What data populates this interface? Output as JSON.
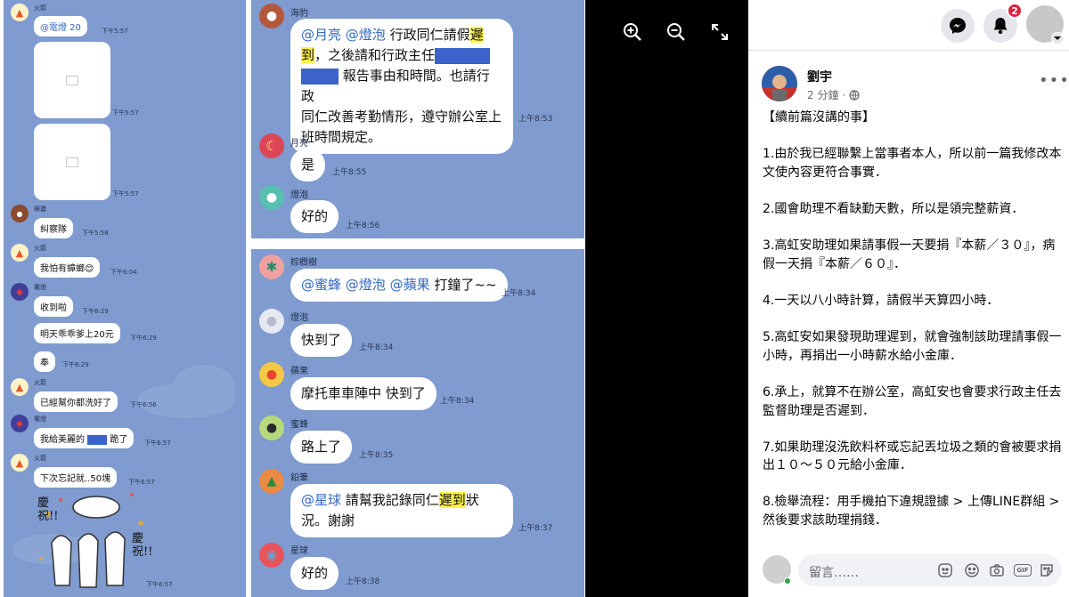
{
  "viewer": {
    "zoom_in": "zoom-in",
    "zoom_out": "zoom-out",
    "fullscreen": "fullscreen"
  },
  "left_chat": [
    {
      "name": "火箭",
      "text": "@電燈  20",
      "time": "下午5:57"
    },
    {
      "time": "下午5:57"
    },
    {
      "time": "下午5:57"
    },
    {
      "name": "檸寶",
      "text": "糾察隊",
      "time": "下午5:58"
    },
    {
      "name": "火箭",
      "text": "我怕有蟑螂😊",
      "time": "下午6:04"
    },
    {
      "name": "電燈",
      "text": "收到啦",
      "time": "下午6:29"
    },
    {
      "text": "明天乖乖爹上20元",
      "time": "下午6:29"
    },
    {
      "text": "奉",
      "time": "下午6:29"
    },
    {
      "name": "火箭",
      "text": "已經幫你都洗好了",
      "time": "下午6:56"
    },
    {
      "name": "電燈",
      "text_a": "我給美麗的",
      "text_b": " 跪了",
      "time": "下午6:57"
    },
    {
      "name": "火箭",
      "text": "下次忘記就..50塊",
      "time": "下午6:57"
    },
    {
      "time": "下午6:57",
      "sticker_a": "慶祝!!",
      "sticker_b": "慶祝!!"
    }
  ],
  "mid_top": {
    "name": "海豹",
    "m1": "@月亮",
    "m2": "@燈泡",
    "t1": " 行政同仁請假",
    "t1h": "遲",
    "t2h": "到",
    "t2": "，之後請和行政主任",
    "t3": " 報告事由和時間。也請行政",
    "t4": "同仁改善考勤情形，遵守辦公室上",
    "t5": "班時間規定。",
    "time": "上午8:53",
    "r2_name": "月亮",
    "r2_text": "是",
    "r2_time": "上午8:55",
    "r3_name": "燈泡",
    "r3_text": "好的",
    "r3_time": "上午8:56"
  },
  "mid_bot": {
    "a_name": "棕櫚樹",
    "a_m1": "@蜜蜂",
    "a_m2": "@燈泡",
    "a_m3": "@蘋果",
    "a_text": " 打鐘了~~",
    "a_time": "上午8:34",
    "b_name": "燈泡",
    "b_text": "快到了",
    "b_time": "上午8:34",
    "c_name": "蘋果",
    "c_text": "摩托車車陣中 快到了",
    "c_time": "上午8:34",
    "d_name": "蜜蜂",
    "d_text": "路上了",
    "d_time": "上午8:35",
    "e_name": "鉛筆",
    "e_m1": "@星球",
    "e_t1": " 請幫我記錄同仁",
    "e_h": "遲到",
    "e_t2": "狀",
    "e_t3": "況。謝謝",
    "e_time": "上午8:37",
    "f_name": "星球",
    "f_text": "好的",
    "f_time": "上午8:38"
  },
  "fb": {
    "badge": "2",
    "author": "劉宇",
    "time": "2 分鐘",
    "text": "【續前篇沒講的事】\n\n1.由於我已經聯繫上當事者本人，所以前一篇我修改本文使內容更符合事實．\n\n2.國會助理不看缺勤天數，所以是領完整薪資．\n\n3.高虹安助理如果請事假一天要捐『本薪／３０』，病假一天捐『本薪／６０』．\n\n4.一天以八小時計算，請假半天算四小時．\n\n5.高虹安如果發現助理遲到，就會強制該助理請事假一小時，再捐出一小時薪水給小金庫．\n\n6.承上，就算不在辦公室，高虹安也會要求行政主任去監督助理是否遲到．\n\n7.如果助理沒洗飲料杯或忘記丟垃圾之類的會被要求捐出１０～５０元給小金庫．\n\n8.檢舉流程：用手機拍下違規證據 > 上傳LINE群組 > 然後要求該助理捐錢．",
    "comment_placeholder": "留言……",
    "gif": "GIF"
  },
  "colors": {
    "line_bg": "#7f9bcf",
    "highlight": "#fff44a",
    "redact": "#3c63c9",
    "fb_badge": "#e41e3f"
  }
}
